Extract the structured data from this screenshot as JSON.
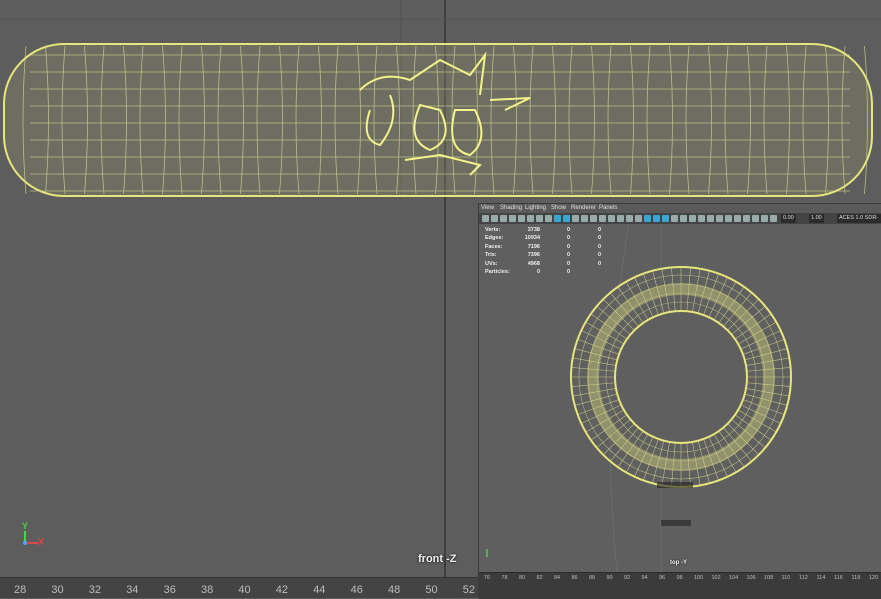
{
  "front_view": {
    "camera_label": "front -Z",
    "axis": {
      "y": "Y",
      "x": "X"
    },
    "timeline_ticks": [
      "28",
      "30",
      "32",
      "34",
      "36",
      "38",
      "40",
      "42",
      "44",
      "46",
      "48",
      "50",
      "52"
    ]
  },
  "top_view": {
    "menu": [
      "View",
      "Shading",
      "Lighting",
      "Show",
      "Renderer",
      "Panels"
    ],
    "toolbar": {
      "field1": "0.00",
      "field2": "1.00",
      "colorspace": "ACES 1.0 SDR-video"
    },
    "hud": [
      {
        "label": "Verts:",
        "v1": "3738",
        "v2": "0",
        "v3": "0"
      },
      {
        "label": "Edges:",
        "v1": "10934",
        "v2": "0",
        "v3": "0"
      },
      {
        "label": "Faces:",
        "v1": "7196",
        "v2": "0",
        "v3": "0"
      },
      {
        "label": "Tris:",
        "v1": "7396",
        "v2": "0",
        "v3": "0"
      },
      {
        "label": "UVs:",
        "v1": "4968",
        "v2": "0",
        "v3": "0"
      },
      {
        "label": "Particles:",
        "v1": "0",
        "v2": "0",
        "v3": ""
      }
    ],
    "camera_label": "top -Y",
    "timeline_ticks": [
      "76",
      "78",
      "80",
      "82",
      "84",
      "86",
      "88",
      "90",
      "92",
      "94",
      "96",
      "98",
      "100",
      "102",
      "104",
      "106",
      "108",
      "110",
      "112",
      "114",
      "116",
      "118",
      "120"
    ]
  },
  "colors": {
    "wire": "#e8e87a",
    "wire_dark": "#8a8a3a",
    "bg": "#5d5d5d"
  }
}
